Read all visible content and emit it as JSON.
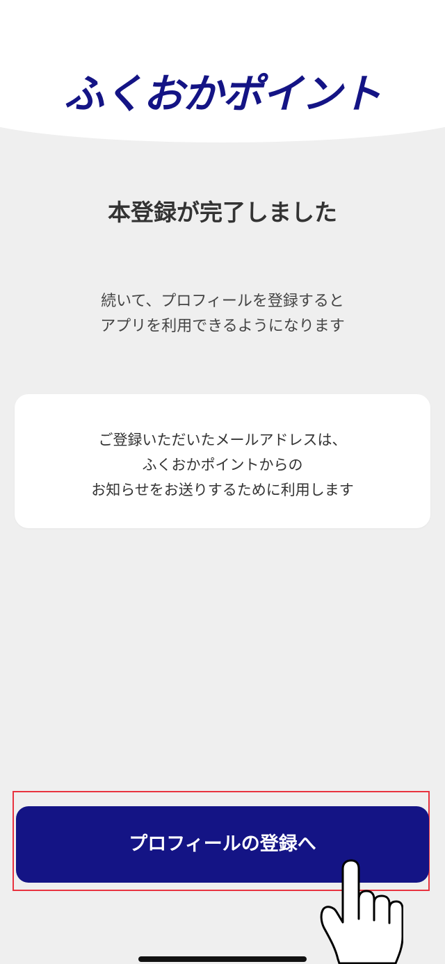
{
  "header": {
    "logo_text": "ふくおかポイント"
  },
  "main": {
    "title": "本登録が完了しました",
    "description_lines": [
      "続いて、プロフィールを登録すると",
      "アプリを利用できるようになります"
    ],
    "note_lines": [
      "ご登録いただいたメールアドレスは、",
      "ふくおかポイントからの",
      "お知らせをお送りするために利用します"
    ]
  },
  "cta": {
    "label": "プロフィールの登録へ"
  },
  "icons": {
    "pointer": "hand-pointer-icon"
  },
  "colors": {
    "brand_navy": "#141485",
    "background": "#efefef",
    "card": "#ffffff",
    "highlight": "#e8333f"
  }
}
